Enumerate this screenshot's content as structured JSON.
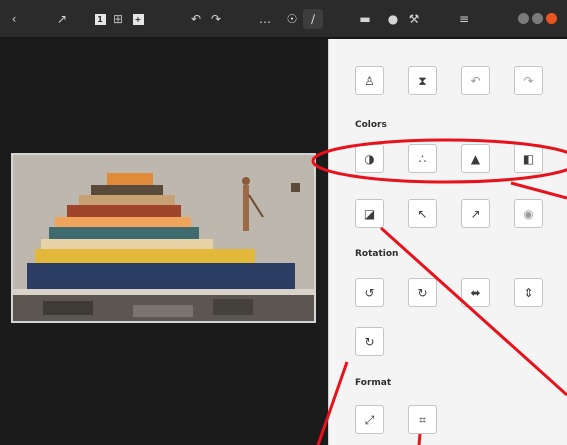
{
  "toolbar": {
    "icons": [
      "back-icon",
      "fullscreen-icon",
      "view-single-icon",
      "view-grid-icon",
      "view-add-icon",
      "undo-icon",
      "redo-icon",
      "more-icon",
      "bulb-icon",
      "pencil-icon",
      "chat-icon",
      "tag-icon",
      "wrench-icon",
      "menu-icon"
    ],
    "window_controls": [
      "minimize",
      "maximize",
      "close"
    ]
  },
  "panel": {
    "sections": {
      "colors": "Colors",
      "rotation": "Rotation",
      "format": "Format"
    },
    "buttons": {
      "top_row": [
        "person-icon",
        "hourglass-icon",
        "undo-icon",
        "redo-icon"
      ],
      "colors_row": [
        "contrast-icon",
        "levels-icon",
        "exposure-icon",
        "gradient-icon"
      ],
      "second_colors_row": [
        "crop-corner-icon",
        "arrow-northwest-icon",
        "arrow-northeast-icon",
        "eye-icon"
      ],
      "rotation_row": [
        "rotate-left-icon",
        "rotate-right-icon",
        "flip-icon",
        "flip-vertical-icon"
      ],
      "rotation_single": [
        "rotate-icon"
      ],
      "format_row": [
        "resize-icon",
        "crop-icon"
      ]
    }
  },
  "colors": {
    "annotation": "#e8121c",
    "toolbar_bg": "#2b2b2b",
    "panel_bg": "#f4f4f4",
    "canvas_bg": "#1b1b1b",
    "win_close": "#e95420"
  }
}
